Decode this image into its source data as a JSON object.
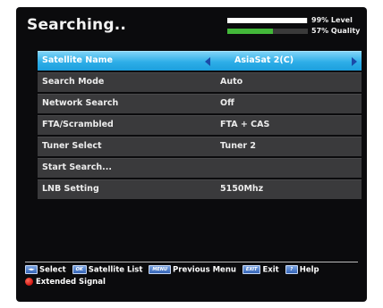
{
  "header": {
    "title": "Searching.."
  },
  "signal": {
    "level_text": "99%  Level",
    "quality_text": "57%  Quality",
    "level_fraction": 0.99,
    "quality_fraction": 0.57,
    "level_color": "#ffffff",
    "quality_color": "#43b83a"
  },
  "menu": {
    "rows": [
      {
        "label": "Satellite Name",
        "value": "AsiaSat 2(C)"
      },
      {
        "label": "Search Mode",
        "value": "Auto"
      },
      {
        "label": "Network Search",
        "value": "Off"
      },
      {
        "label": "FTA/Scrambled",
        "value": "FTA + CAS"
      },
      {
        "label": "Tuner Select",
        "value": "Tuner 2"
      },
      {
        "label": "Start Search...",
        "value": ""
      },
      {
        "label": "LNB Setting",
        "value": "5150Mhz"
      }
    ]
  },
  "footer": {
    "hints": [
      {
        "key": "◄►",
        "label": "Select"
      },
      {
        "key": "OK",
        "label": "Satellite List"
      },
      {
        "key": "MENU",
        "label": "Previous Menu"
      },
      {
        "key": "EXIT",
        "label": "Exit"
      },
      {
        "key": "?",
        "label": "Help"
      }
    ],
    "extended_label": "Extended Signal"
  },
  "icons": {
    "left_arrow": "left-arrow-icon",
    "right_arrow": "right-arrow-icon",
    "red_button": "red-button-icon"
  }
}
